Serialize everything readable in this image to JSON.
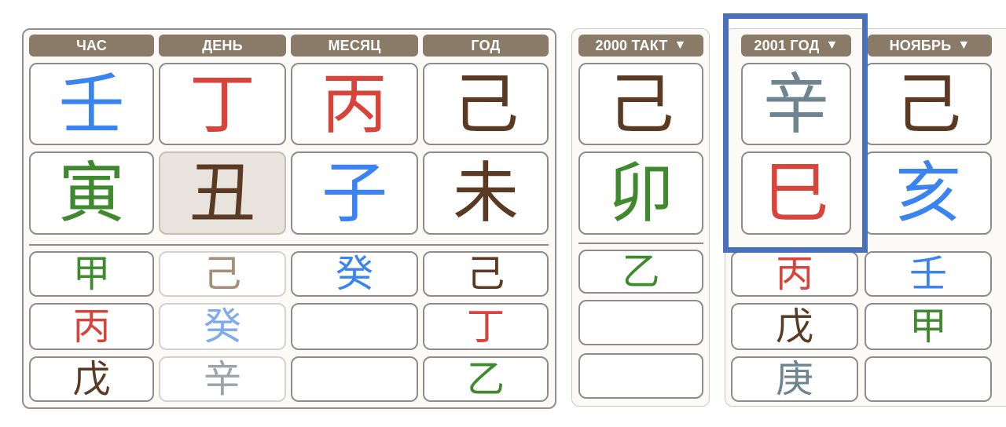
{
  "natal": {
    "headers": [
      "ЧАС",
      "ДЕНЬ",
      "МЕСЯЦ",
      "ГОД"
    ],
    "stems": [
      {
        "char": "壬",
        "color": "#3b83f0"
      },
      {
        "char": "丁",
        "color": "#d8443a"
      },
      {
        "char": "丙",
        "color": "#d8443a"
      },
      {
        "char": "己",
        "color": "#5b3a24"
      }
    ],
    "branches": [
      {
        "char": "寅",
        "color": "#3f8a2e"
      },
      {
        "char": "丑",
        "color": "#5b3a24"
      },
      {
        "char": "子",
        "color": "#3b83f0"
      },
      {
        "char": "未",
        "color": "#5b3a24"
      }
    ],
    "hidden": [
      [
        "甲",
        "己",
        "癸",
        "己"
      ],
      [
        "丙",
        "癸",
        "",
        "丁"
      ],
      [
        "戊",
        "辛",
        "",
        "乙"
      ]
    ]
  },
  "takt": {
    "header": "2000 ТАКТ",
    "arrow": "▼",
    "stem": {
      "char": "己",
      "color": "#5b3a24"
    },
    "branch": {
      "char": "卯",
      "color": "#3f8a2e"
    },
    "hidden": [
      "乙",
      "",
      ""
    ]
  },
  "year": {
    "header": "2001 ГОД",
    "arrow": "▼",
    "stem": {
      "char": "辛",
      "color": "#6f8491"
    },
    "branch": {
      "char": "巳",
      "color": "#d8443a"
    },
    "hidden": [
      "丙",
      "戊",
      "庚"
    ]
  },
  "month": {
    "header": "НОЯБРЬ",
    "arrow": "▼",
    "stem": {
      "char": "己",
      "color": "#5b3a24"
    },
    "branch": {
      "char": "亥",
      "color": "#3b83f0"
    },
    "hidden": [
      "壬",
      "甲",
      ""
    ]
  },
  "highlight": {
    "color": "#4a6fbd",
    "target": "year-column"
  }
}
